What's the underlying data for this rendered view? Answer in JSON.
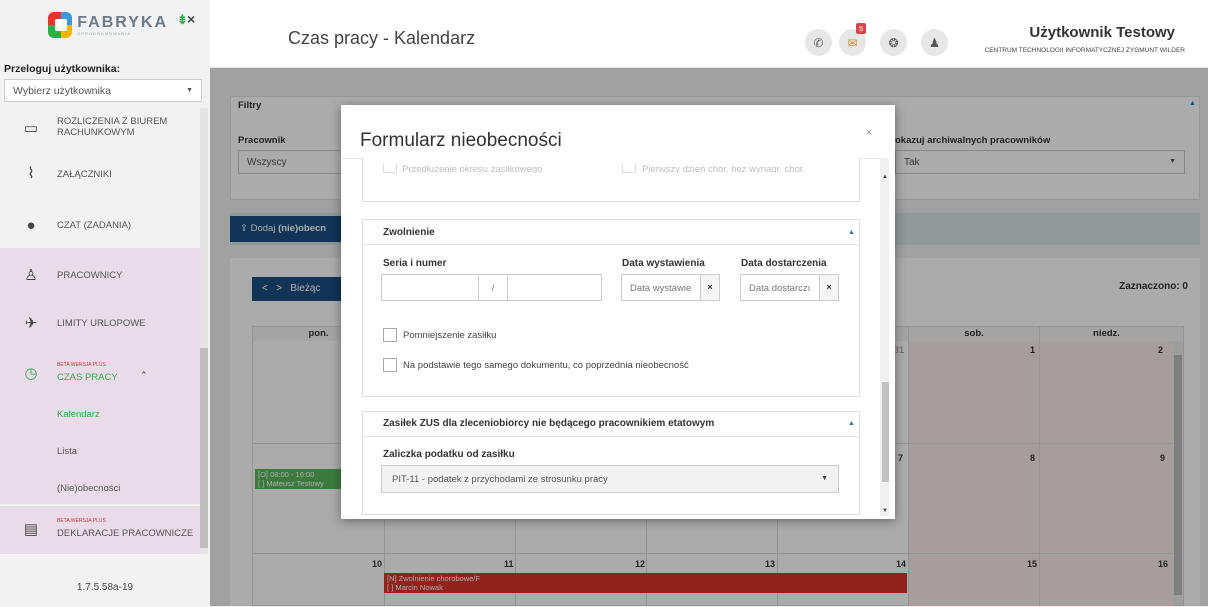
{
  "app": {
    "logo_text": "FABRYKA",
    "logo_sub": "OPROGRAMOWANIA",
    "version": "1.7.5.58a-19"
  },
  "sidebar": {
    "impersonate_label": "Przeloguj użytkownika:",
    "impersonate_value": "Wybierz użytkownika",
    "items": [
      {
        "label": "ROZLICZENIA Z BIUREM RACHUNKOWYM",
        "icon": "keyboard-icon"
      },
      {
        "label": "ZAŁĄCZNIKI",
        "icon": "paperclip-icon"
      },
      {
        "label": "CZAT (ZADANIA)",
        "icon": "chat-icon"
      },
      {
        "label": "PRACOWNICY",
        "icon": "person-icon"
      },
      {
        "label": "LIMITY URLOPOWE",
        "icon": "plane-icon"
      },
      {
        "label": "CZAS PRACY",
        "beta": "BETA WERSJA PLUS",
        "icon": "clock-icon"
      },
      {
        "label": "Kalendarz"
      },
      {
        "label": "Lista"
      },
      {
        "label": "(Nie)obecności"
      },
      {
        "label": "DEKLARACJE PRACOWNICZE",
        "beta": "BETA WERSJA PLUS",
        "icon": "book-icon"
      }
    ]
  },
  "header": {
    "title": "Czas pracy - Kalendarz",
    "mail_badge": "5",
    "user_name": "Użytkownik Testowy",
    "user_org": "CENTRUM TECHNOLOGII INFORMATYCZNEJ ZYGMUNT WILDER"
  },
  "filters": {
    "title": "Filtry",
    "employee_label": "Pracownik",
    "employee_value": "Wszyscy",
    "archival_label": "okazuj archiwalnych pracowników",
    "archival_value": "Tak"
  },
  "actions": {
    "add_label": "Dodaj",
    "add_bold": "(nie)obecn"
  },
  "calendar": {
    "nav_label": "Bieżąc",
    "selected": "Zaznaczono: 0",
    "headers": [
      "pon.",
      "sob.",
      "niedz."
    ],
    "week1_nums": [
      "31",
      "1",
      "2"
    ],
    "week2_nums": [
      "7",
      "8",
      "9"
    ],
    "week3_nums": [
      "10",
      "11",
      "12",
      "13",
      "14",
      "15",
      "16"
    ],
    "event1_line1": "[O] 08:00 - 16:00",
    "event1_line2": "[ ] Mateusz Testowy",
    "event2_line1": "[N] Zwolnienie chorobowe/F",
    "event2_line2": "[ ] Marcin Nowak"
  },
  "modal": {
    "title": "Formularz nieobecności",
    "faded_left": "Przedłużenie okresu zasiłkowego",
    "faded_right": "Pierwszy dzień chor. bez wynagr. chor.",
    "section1": {
      "title": "Zwolnienie",
      "series_label": "Seria i numer",
      "separator": "/",
      "issued_label": "Data wystawienia",
      "issued_placeholder": "Data wystawie",
      "delivered_label": "Data dostarczenia",
      "delivered_placeholder": "Data dostarczı",
      "clear": "×",
      "check1": "Pomniejszenie zasiłku",
      "check2": "Na podstawie tego samego dokumentu, co poprzednia nieobecność"
    },
    "section2": {
      "title": "Zasiłek ZUS dla zleceniobiorcy nie będącego pracownikiem etatowym",
      "tax_label": "Zaliczka podatku od zasiłku",
      "tax_value": "PIT-11 - podatek z przychodami ze strosunku pracy"
    },
    "close": "×"
  }
}
